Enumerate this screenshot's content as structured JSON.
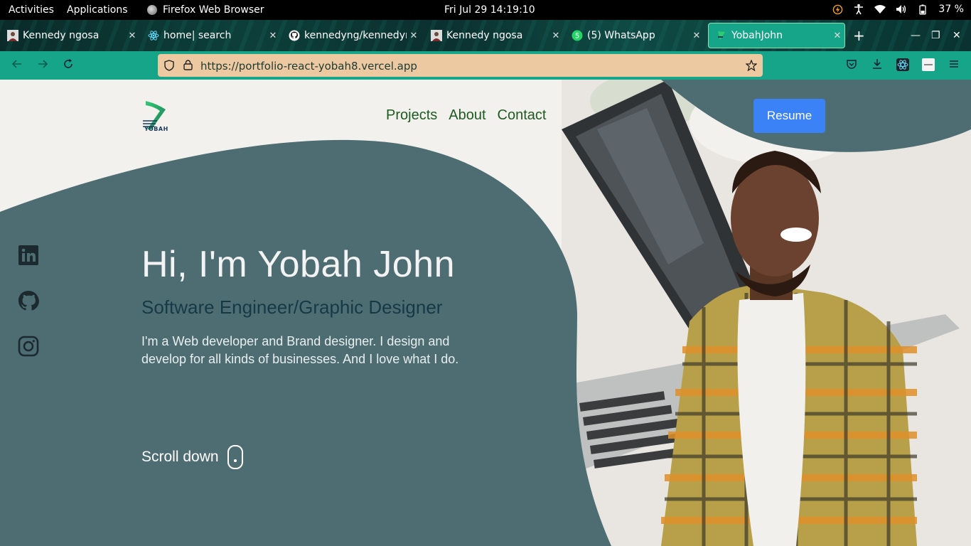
{
  "system_bar": {
    "activities": "Activities",
    "applications": "Applications",
    "app_name": "Firefox Web Browser",
    "clock": "Fri Jul 29  14:19:10",
    "battery": "37 %"
  },
  "tabs": [
    {
      "title": "Kennedy ngosa",
      "icon": "profile-photo-icon"
    },
    {
      "title": "home| search",
      "icon": "react-icon"
    },
    {
      "title": "kennedyng/kennedyng",
      "icon": "github-icon"
    },
    {
      "title": "Kennedy ngosa",
      "icon": "profile-photo-icon"
    },
    {
      "title": "(5) WhatsApp",
      "icon": "whatsapp-icon",
      "badge": "5"
    },
    {
      "title": "YobahJohn",
      "icon": "yobah-logo-icon",
      "active": true
    }
  ],
  "navbar": {
    "url": "https://portfolio-react-yobah8.vercel.app"
  },
  "site": {
    "logo_text": "YOBAH",
    "nav": [
      "Projects",
      "About",
      "Contact"
    ],
    "resume": "Resume",
    "hero_title": "Hi, I'm Yobah John",
    "hero_subtitle": "Software Engineer/Graphic Designer",
    "hero_description": "I'm a Web developer and Brand designer. I design and develop for all kinds of businesses. And I love what I do.",
    "scroll_label": "Scroll down",
    "social": [
      "linkedin-icon",
      "github-icon",
      "instagram-icon"
    ]
  },
  "colors": {
    "accent_teal": "#17a589",
    "hero_blob": "#4e6d73",
    "resume_blue": "#3b82f6",
    "nav_green": "#1e5b20",
    "url_bar": "#ecc9a0"
  }
}
